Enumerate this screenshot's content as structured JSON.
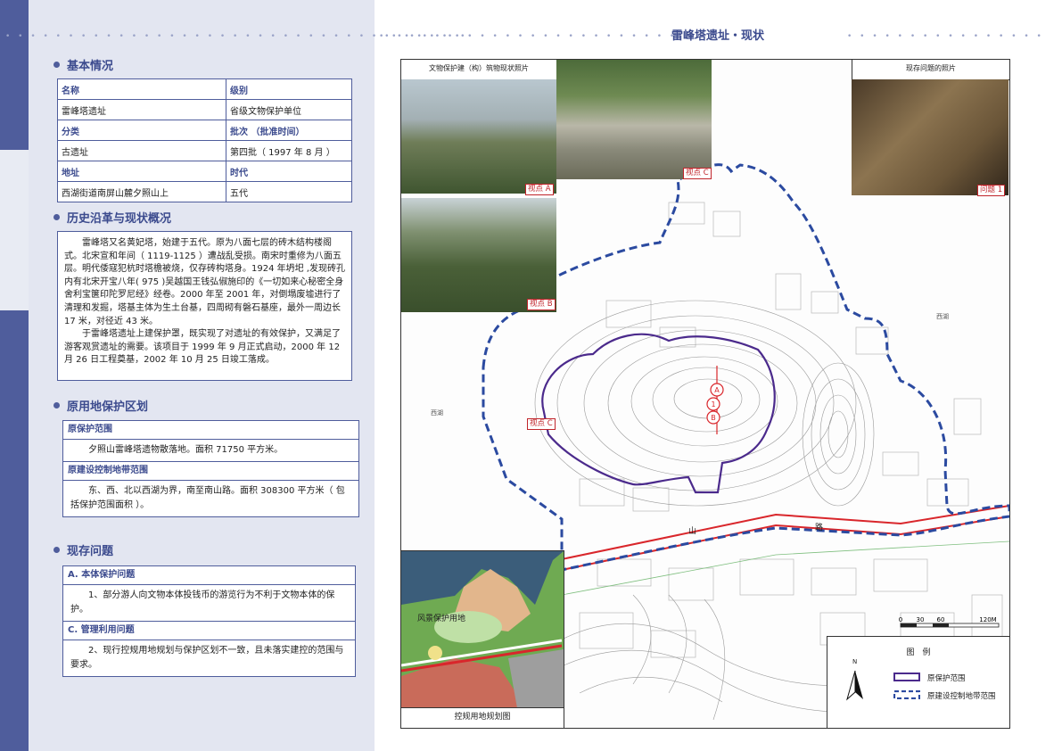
{
  "page_title": "雷峰塔遗址・现状",
  "basic": {
    "title": "基本情况",
    "rows": [
      [
        "名称",
        "级别"
      ],
      [
        "雷峰塔遗址",
        "省级文物保护单位"
      ],
      [
        "分类",
        "批次 （批准时间）"
      ],
      [
        "古遗址",
        "第四批（ 1997 年 8 月 ）"
      ],
      [
        "地址",
        "时代"
      ],
      [
        "西湖街道南屏山麓夕照山上",
        "五代"
      ]
    ]
  },
  "history": {
    "title": "历史沿革与现状概况",
    "p1": "雷峰塔又名黄妃塔，始建于五代。原为八面七层的砖木结构楼阁式。北宋宣和年间（ 1119-1125 ）遭战乱受损。南宋时重修为八面五层。明代倭寇犯杭时塔檐被烧，仅存砖构塔身。1924 年坍圯 ,发现砖孔内有北宋开宝八年( 975 )吴越国王钱弘俶施印的《一切如来心秘密全身舍利宝箧印陀罗尼经》经卷。2000 年至 2001 年，对倒塌废墟进行了清理和发掘，塔基主体为生土台基，四周砌有磐石基座，最外一周边长 17 米，对径近 43 米。",
    "p2": "于雷峰塔遗址上建保护罩，既实现了对遗址的有效保护，又满足了游客观赏遗址的需要。该项目于 1999 年 9 月正式启动，2000 年 12 月 26 日工程奠基，2002 年 10 月 25 日竣工落成。"
  },
  "zoning": {
    "title": "原用地保护区划",
    "range_head": "原保护范围",
    "range_body": "夕照山雷峰塔遗物散落地。面积 71750 平方米。",
    "ctrl_head": "原建设控制地带范围",
    "ctrl_body": "东、西、北以西湖为界，南至南山路。面积 308300 平方米（ 包括保护范围面积 ）。"
  },
  "issues": {
    "title": "现存问题",
    "a_head": "A. 本体保护问题",
    "a_body": "1、部分游人向文物本体投钱币的游览行为不利于文物本体的保护。",
    "c_head": "C. 管理利用问题",
    "c_body": "2、现行控规用地规划与保护区划不一致，且未落实建控的范围与要求。"
  },
  "map": {
    "photo_caption": "文物保护建（构）筑物现状照片",
    "problem_caption": "现存问题的照片",
    "view_a": "视点 A",
    "view_b": "视点 B",
    "view_c_photo": "视点 C",
    "view_c_map": "视点 C",
    "problem_1": "问题 1",
    "plan_caption": "控规用地规划图",
    "plan_label": "风景保护用地",
    "road_1": "山",
    "road_2": "路",
    "marker_a": "A",
    "marker_1": "1",
    "marker_b": "B",
    "west_lake_1": "西湖",
    "west_lake_2": "西湖",
    "scale_0": "0",
    "scale_30": "30",
    "scale_60": "60",
    "scale_120": "120M",
    "legend_title": "图　例",
    "legend_north": "N",
    "legend_range": "原保护范围",
    "legend_ctrl": "原建设控制地带范围"
  },
  "colors": {
    "accent": "#4f5d9c",
    "protect_line": "#4b2a8c",
    "control_line": "#2b4aa0",
    "road": "#d9262b"
  }
}
